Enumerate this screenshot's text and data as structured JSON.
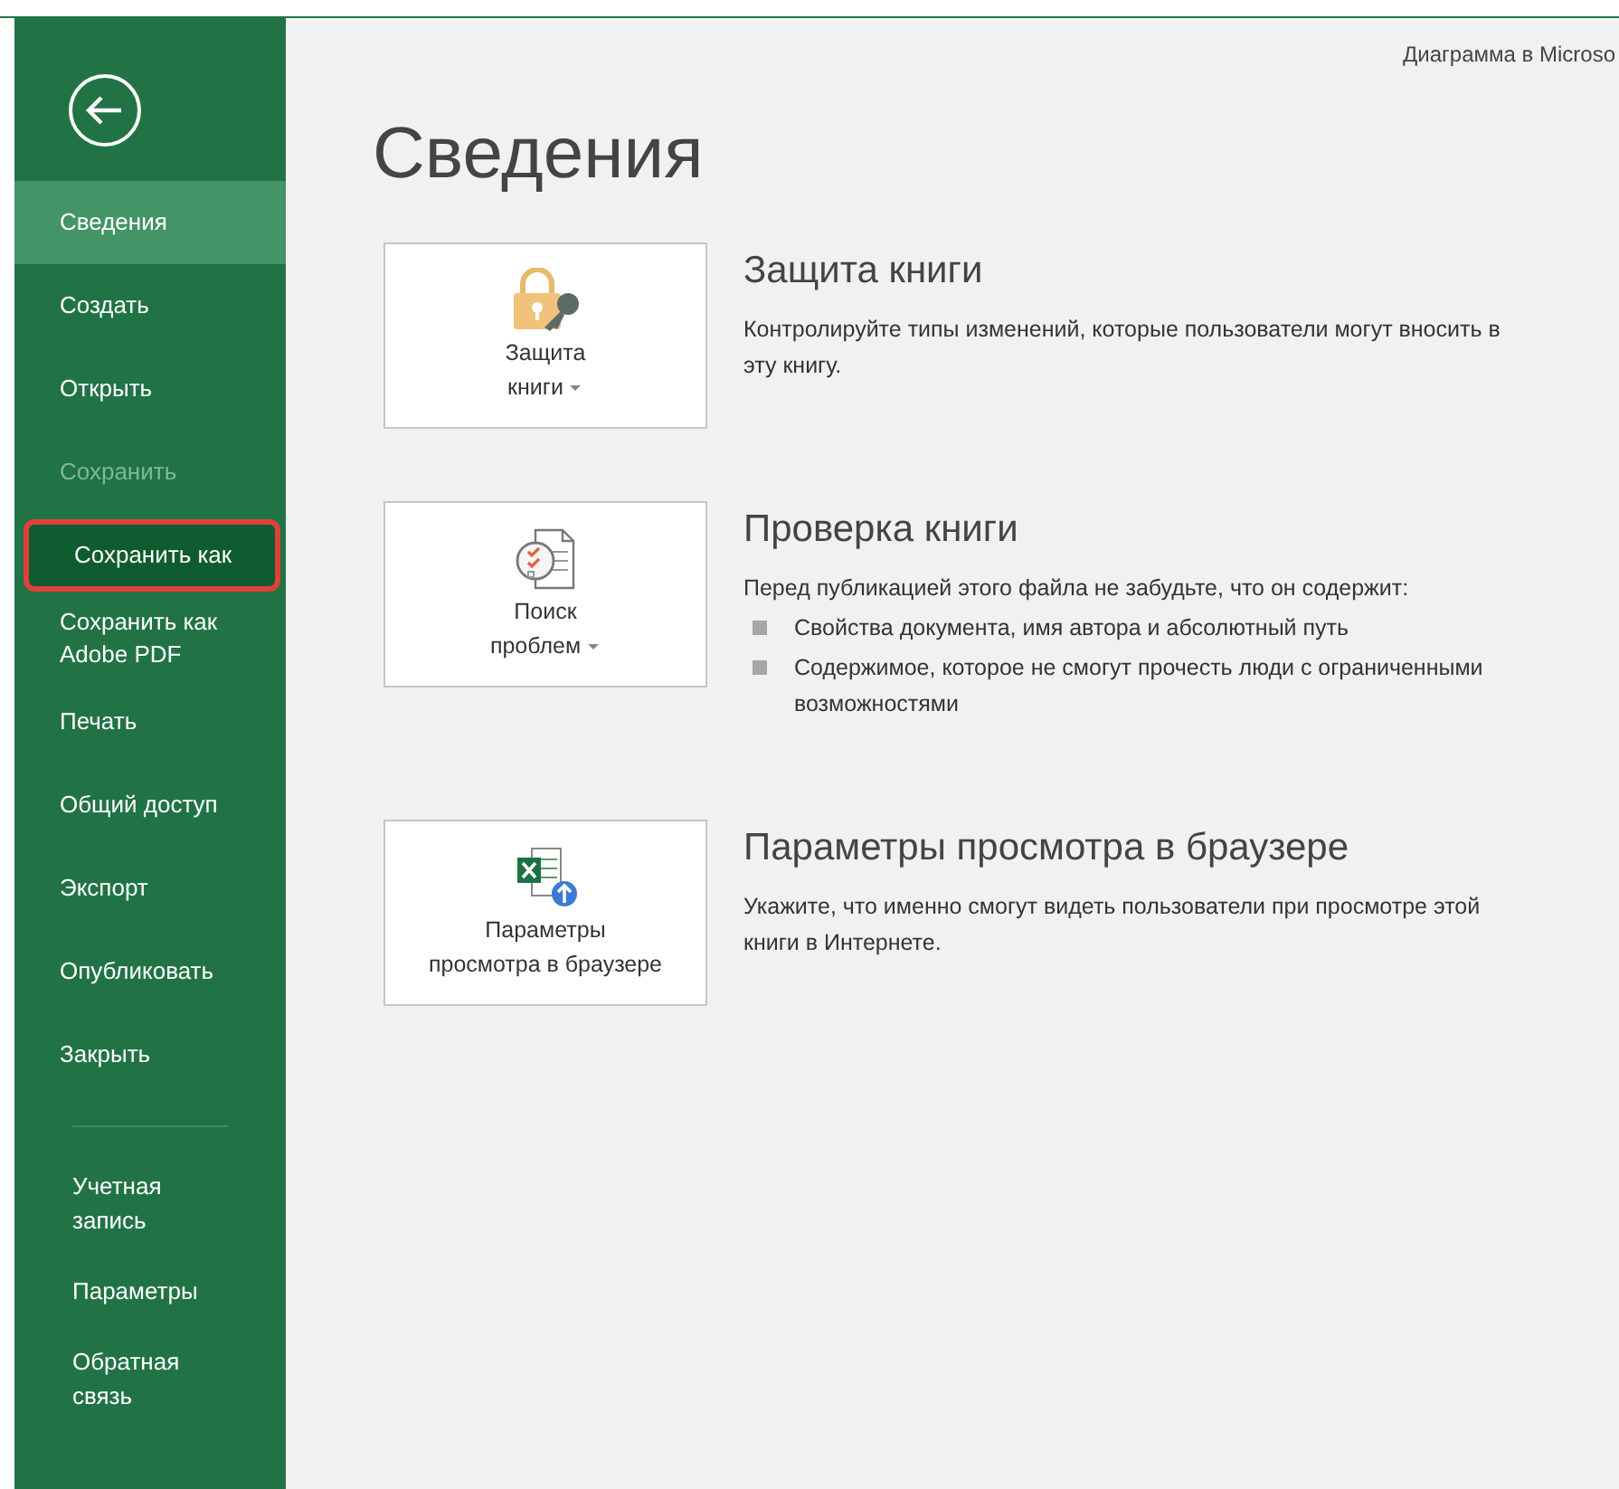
{
  "window": {
    "title": "Диаграмма в Microso"
  },
  "sidebar": {
    "items": [
      {
        "label": "Сведения",
        "selected": true,
        "disabled": false,
        "highlighted": false
      },
      {
        "label": "Создать",
        "selected": false,
        "disabled": false,
        "highlighted": false
      },
      {
        "label": "Открыть",
        "selected": false,
        "disabled": false,
        "highlighted": false
      },
      {
        "label": "Сохранить",
        "selected": false,
        "disabled": true,
        "highlighted": false
      },
      {
        "label": "Сохранить как",
        "selected": false,
        "disabled": false,
        "highlighted": true
      },
      {
        "label": "Сохранить как Adobe PDF",
        "selected": false,
        "disabled": false,
        "highlighted": false
      },
      {
        "label": "Печать",
        "selected": false,
        "disabled": false,
        "highlighted": false
      },
      {
        "label": "Общий доступ",
        "selected": false,
        "disabled": false,
        "highlighted": false
      },
      {
        "label": "Экспорт",
        "selected": false,
        "disabled": false,
        "highlighted": false
      },
      {
        "label": "Опубликовать",
        "selected": false,
        "disabled": false,
        "highlighted": false
      },
      {
        "label": "Закрыть",
        "selected": false,
        "disabled": false,
        "highlighted": false
      }
    ],
    "footer_items": [
      {
        "label": "Учетная запись",
        "selected": false
      },
      {
        "label": "Параметры",
        "selected": false
      },
      {
        "label": "Обратная связь",
        "selected": false
      }
    ]
  },
  "heading": "Сведения",
  "sections": [
    {
      "kind": "protect",
      "button_lines": [
        "Защита",
        "книги"
      ],
      "dropdown": true,
      "title": "Защита книги",
      "description": "Контролируйте типы изменений, которые пользователи могут вносить в эту книгу."
    },
    {
      "kind": "inspect",
      "button_lines": [
        "Поиск",
        "проблем"
      ],
      "dropdown": true,
      "title": "Проверка книги",
      "description": "Перед публикацией этого файла не забудьте, что он содержит:",
      "bullets": [
        "Свойства документа, имя автора и абсолютный путь",
        "Содержимое, которое не смогут прочесть люди с ограниченными возможностями"
      ]
    },
    {
      "kind": "browser",
      "button_lines": [
        "Параметры",
        "просмотра в браузере"
      ],
      "dropdown": false,
      "title": "Параметры просмотра в браузере",
      "description": "Укажите, что именно смогут видеть пользователи при просмотре этой книги в Интернете."
    }
  ]
}
